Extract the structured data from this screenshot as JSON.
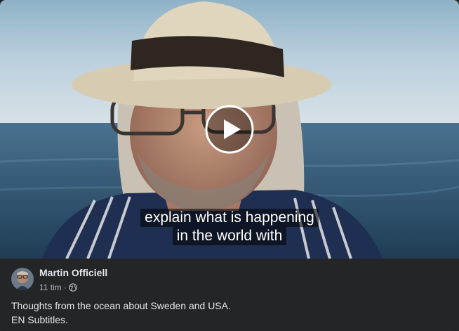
{
  "post": {
    "author": "Martin Officiell",
    "timestamp": "11 tim",
    "separator": "·",
    "privacy_icon": "globe-icon",
    "text_lines": [
      "Thoughts from the ocean about Sweden and USA.",
      "EN Subtitles."
    ]
  },
  "video": {
    "subtitle_lines": [
      "explain what is happening",
      "in the world with"
    ],
    "play_icon": "play-icon"
  },
  "colors": {
    "background": "#242526",
    "primary_text": "#e4e6eb",
    "secondary_text": "#b0b3b8"
  }
}
